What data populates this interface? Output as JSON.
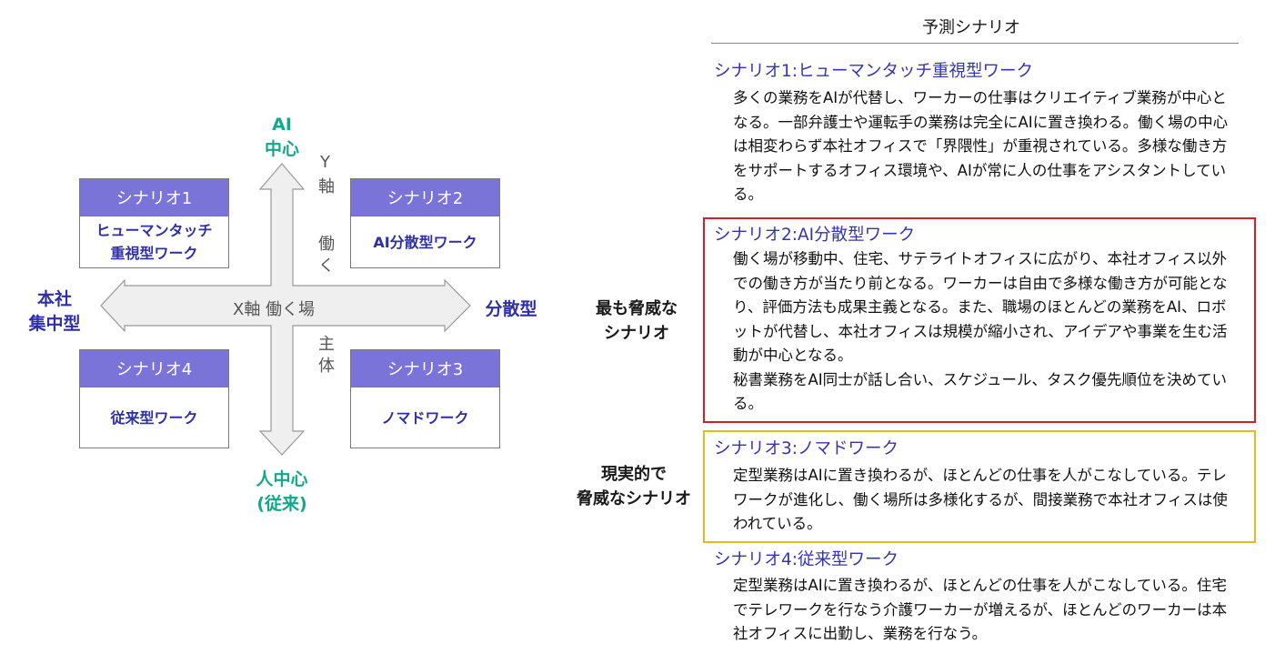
{
  "axes": {
    "top": "AI\n中心",
    "bottom": "人中心\n(従来)",
    "left": "本社\n集中型",
    "right": "分散型",
    "y_axis_top": "Y軸",
    "y_axis_mid": "働く",
    "y_axis_bottom": "主体",
    "x_axis": "X軸 働く場"
  },
  "quadrants": [
    {
      "header": "シナリオ1",
      "body": "ヒューマンタッチ\n重視型ワーク"
    },
    {
      "header": "シナリオ2",
      "body": "AI分散型ワーク"
    },
    {
      "header": "シナリオ4",
      "body": "従来型ワーク"
    },
    {
      "header": "シナリオ3",
      "body": "ノマドワーク"
    }
  ],
  "right_title": "予測シナリオ",
  "scenarios": [
    {
      "title": "シナリオ1:ヒューマンタッチ重視型ワーク",
      "body": "多くの業務をAIが代替し、ワーカーの仕事はクリエイティブ業務が中心となる。一部弁護士や運転手の業務は完全にAIに置き換わる。働く場の中心は相変わらず本社オフィスで「界隈性」が重視されている。多様な働き方をサポートするオフィス環境や、AIが常に人の仕事をアシスタントしている。"
    },
    {
      "title": "シナリオ2:AI分散型ワーク",
      "body": "働く場が移動中、住宅、サテライトオフィスに広がり、本社オフィス以外での働き方が当たり前となる。ワーカーは自由で多様な働き方が可能となり、評価方法も成果主義となる。また、職場のほとんどの業務をAI、ロボットが代替し、本社オフィスは規模が縮小され、アイデアや事業を生む活動が中心となる。\n秘書業務をAI同士が話し合い、スケジュール、タスク優先順位を決めている。"
    },
    {
      "title": "シナリオ3:ノマドワーク",
      "body": "定型業務はAIに置き換わるが、ほとんどの仕事を人がこなしている。テレワークが進化し、働く場所は多様化するが、間接業務で本社オフィスは使われている。"
    },
    {
      "title": "シナリオ4:従来型ワーク",
      "body": "定型業務はAIに置き換わるが、ほとんどの仕事を人がこなしている。住宅でテレワークを行なう介護ワーカーが増えるが、ほとんどのワーカーは本社オフィスに出勤し、業務を行なう。"
    }
  ],
  "labels": {
    "most_threat": "最も脅威な\nシナリオ",
    "real_threat": "現実的で\n脅威なシナリオ"
  },
  "colors": {
    "accent_green": "#14a78a",
    "accent_blue": "#2f2fa8",
    "box_header": "#7b74d8",
    "frame_red": "#d0202a",
    "frame_yellow": "#e8b820"
  }
}
